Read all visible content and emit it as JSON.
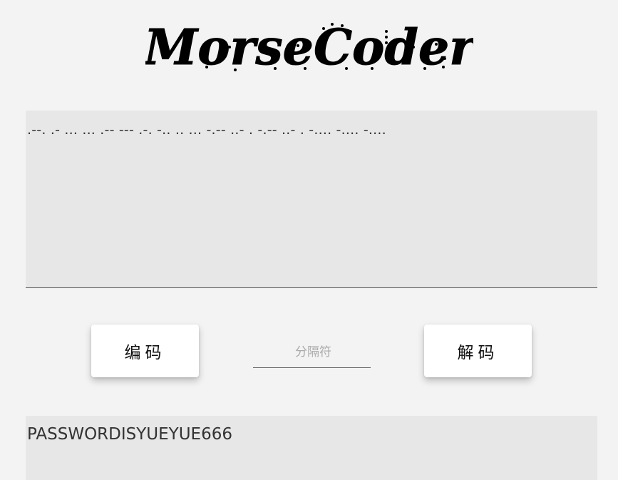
{
  "header": {
    "logo_text": "MorseCoder"
  },
  "input": {
    "value": ".--. .- ... ... .-- --- .-. -.. .. ... -.-- ..- . -.-- ..- . -.... -.... -...."
  },
  "controls": {
    "encode_label": "编码",
    "decode_label": "解码",
    "separator_placeholder": "分隔符",
    "separator_value": ""
  },
  "output": {
    "value": "PASSWORDISYUEYUE666"
  }
}
